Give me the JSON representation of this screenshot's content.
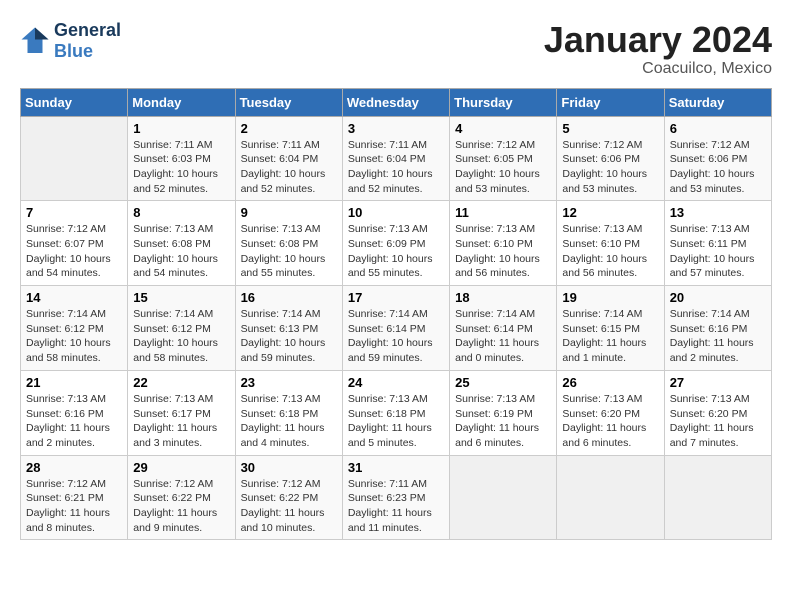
{
  "header": {
    "logo_line1": "General",
    "logo_line2": "Blue",
    "month": "January 2024",
    "location": "Coacuilco, Mexico"
  },
  "days_of_week": [
    "Sunday",
    "Monday",
    "Tuesday",
    "Wednesday",
    "Thursday",
    "Friday",
    "Saturday"
  ],
  "weeks": [
    [
      {
        "day": "",
        "empty": true
      },
      {
        "day": "1",
        "sunrise": "7:11 AM",
        "sunset": "6:03 PM",
        "daylight": "10 hours and 52 minutes."
      },
      {
        "day": "2",
        "sunrise": "7:11 AM",
        "sunset": "6:04 PM",
        "daylight": "10 hours and 52 minutes."
      },
      {
        "day": "3",
        "sunrise": "7:11 AM",
        "sunset": "6:04 PM",
        "daylight": "10 hours and 52 minutes."
      },
      {
        "day": "4",
        "sunrise": "7:12 AM",
        "sunset": "6:05 PM",
        "daylight": "10 hours and 53 minutes."
      },
      {
        "day": "5",
        "sunrise": "7:12 AM",
        "sunset": "6:06 PM",
        "daylight": "10 hours and 53 minutes."
      },
      {
        "day": "6",
        "sunrise": "7:12 AM",
        "sunset": "6:06 PM",
        "daylight": "10 hours and 53 minutes."
      }
    ],
    [
      {
        "day": "7",
        "sunrise": "7:12 AM",
        "sunset": "6:07 PM",
        "daylight": "10 hours and 54 minutes."
      },
      {
        "day": "8",
        "sunrise": "7:13 AM",
        "sunset": "6:08 PM",
        "daylight": "10 hours and 54 minutes."
      },
      {
        "day": "9",
        "sunrise": "7:13 AM",
        "sunset": "6:08 PM",
        "daylight": "10 hours and 55 minutes."
      },
      {
        "day": "10",
        "sunrise": "7:13 AM",
        "sunset": "6:09 PM",
        "daylight": "10 hours and 55 minutes."
      },
      {
        "day": "11",
        "sunrise": "7:13 AM",
        "sunset": "6:10 PM",
        "daylight": "10 hours and 56 minutes."
      },
      {
        "day": "12",
        "sunrise": "7:13 AM",
        "sunset": "6:10 PM",
        "daylight": "10 hours and 56 minutes."
      },
      {
        "day": "13",
        "sunrise": "7:13 AM",
        "sunset": "6:11 PM",
        "daylight": "10 hours and 57 minutes."
      }
    ],
    [
      {
        "day": "14",
        "sunrise": "7:14 AM",
        "sunset": "6:12 PM",
        "daylight": "10 hours and 58 minutes."
      },
      {
        "day": "15",
        "sunrise": "7:14 AM",
        "sunset": "6:12 PM",
        "daylight": "10 hours and 58 minutes."
      },
      {
        "day": "16",
        "sunrise": "7:14 AM",
        "sunset": "6:13 PM",
        "daylight": "10 hours and 59 minutes."
      },
      {
        "day": "17",
        "sunrise": "7:14 AM",
        "sunset": "6:14 PM",
        "daylight": "10 hours and 59 minutes."
      },
      {
        "day": "18",
        "sunrise": "7:14 AM",
        "sunset": "6:14 PM",
        "daylight": "11 hours and 0 minutes."
      },
      {
        "day": "19",
        "sunrise": "7:14 AM",
        "sunset": "6:15 PM",
        "daylight": "11 hours and 1 minute."
      },
      {
        "day": "20",
        "sunrise": "7:14 AM",
        "sunset": "6:16 PM",
        "daylight": "11 hours and 2 minutes."
      }
    ],
    [
      {
        "day": "21",
        "sunrise": "7:13 AM",
        "sunset": "6:16 PM",
        "daylight": "11 hours and 2 minutes."
      },
      {
        "day": "22",
        "sunrise": "7:13 AM",
        "sunset": "6:17 PM",
        "daylight": "11 hours and 3 minutes."
      },
      {
        "day": "23",
        "sunrise": "7:13 AM",
        "sunset": "6:18 PM",
        "daylight": "11 hours and 4 minutes."
      },
      {
        "day": "24",
        "sunrise": "7:13 AM",
        "sunset": "6:18 PM",
        "daylight": "11 hours and 5 minutes."
      },
      {
        "day": "25",
        "sunrise": "7:13 AM",
        "sunset": "6:19 PM",
        "daylight": "11 hours and 6 minutes."
      },
      {
        "day": "26",
        "sunrise": "7:13 AM",
        "sunset": "6:20 PM",
        "daylight": "11 hours and 6 minutes."
      },
      {
        "day": "27",
        "sunrise": "7:13 AM",
        "sunset": "6:20 PM",
        "daylight": "11 hours and 7 minutes."
      }
    ],
    [
      {
        "day": "28",
        "sunrise": "7:12 AM",
        "sunset": "6:21 PM",
        "daylight": "11 hours and 8 minutes."
      },
      {
        "day": "29",
        "sunrise": "7:12 AM",
        "sunset": "6:22 PM",
        "daylight": "11 hours and 9 minutes."
      },
      {
        "day": "30",
        "sunrise": "7:12 AM",
        "sunset": "6:22 PM",
        "daylight": "11 hours and 10 minutes."
      },
      {
        "day": "31",
        "sunrise": "7:11 AM",
        "sunset": "6:23 PM",
        "daylight": "11 hours and 11 minutes."
      },
      {
        "day": "",
        "empty": true
      },
      {
        "day": "",
        "empty": true
      },
      {
        "day": "",
        "empty": true
      }
    ]
  ]
}
